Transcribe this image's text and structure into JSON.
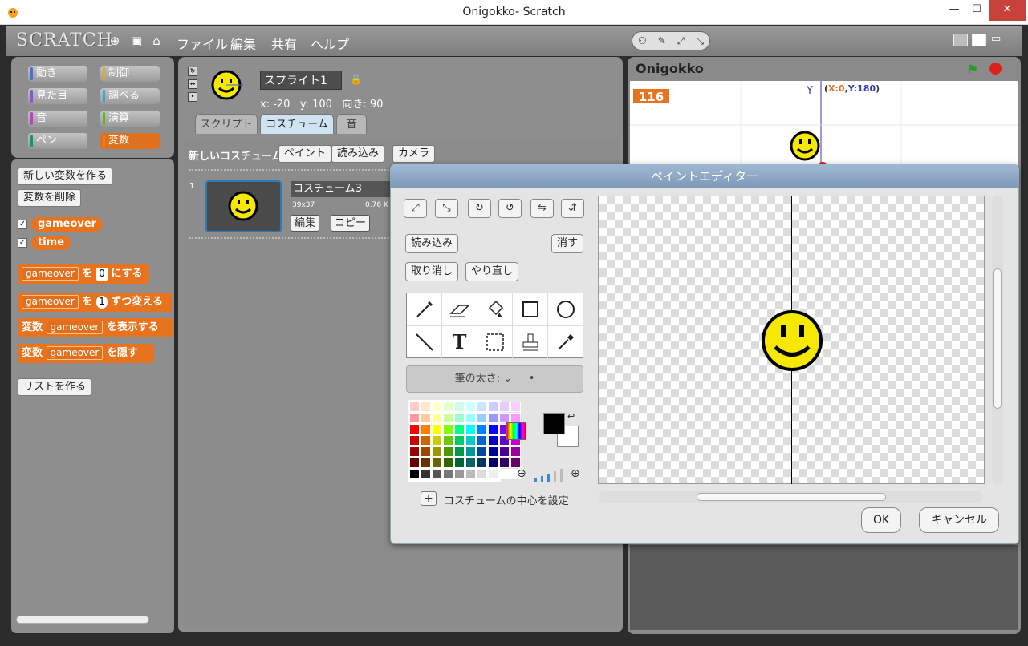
{
  "window": {
    "title": "Onigokko- Scratch",
    "minimize": "—",
    "maximize": "☐",
    "close": "✕"
  },
  "topbar": {
    "logo": "SCRATCH",
    "menus": [
      "ファイル",
      "編集",
      "共有",
      "ヘルプ"
    ],
    "mode_buttons": [
      "⚇",
      "✎",
      "⤢",
      "⤡"
    ]
  },
  "categories": [
    {
      "label": "動き",
      "color": "#4a6cd4"
    },
    {
      "label": "制御",
      "color": "#e1a91a"
    },
    {
      "label": "見た目",
      "color": "#8a55d7"
    },
    {
      "label": "調べる",
      "color": "#2ca5e2"
    },
    {
      "label": "音",
      "color": "#bb42c3"
    },
    {
      "label": "演算",
      "color": "#5cb712"
    },
    {
      "label": "ペン",
      "color": "#0e9a6c"
    },
    {
      "label": "変数",
      "color": "#ee7d16"
    }
  ],
  "palette": {
    "make_var": "新しい変数を作る",
    "delete_var": "変数を削除",
    "variables": [
      "gameover",
      "time"
    ],
    "blocks": {
      "set": {
        "var": "gameover",
        "to": "を",
        "value": "0",
        "suffix": "にする"
      },
      "change": {
        "var": "gameover",
        "by": "を",
        "value": "1",
        "suffix": "ずつ変える"
      },
      "show": {
        "prefix": "変数",
        "var": "gameover",
        "suffix": "を表示する"
      },
      "hide": {
        "prefix": "変数",
        "var": "gameover",
        "suffix": "を隠す"
      }
    },
    "make_list": "リストを作る"
  },
  "sprite": {
    "name": "スプライト1",
    "x_label": "x:",
    "x": "-20",
    "y_label": "y:",
    "y": "100",
    "dir_label": "向き:",
    "dir": "90"
  },
  "tabs": [
    "スクリプト",
    "コスチューム",
    "音"
  ],
  "costumes": {
    "new_label": "新しいコスチューム",
    "paint": "ペイント",
    "import": "読み込み",
    "camera": "カメラ",
    "index": "1",
    "name": "コスチューム3",
    "size": "39x37",
    "kb": "0.76 K",
    "edit": "編集",
    "copy": "コピー"
  },
  "stage": {
    "title": "Onigokko",
    "monitor_value": "116",
    "y_axis": "Y",
    "readout_x": "X:0",
    "readout_y": "Y:180"
  },
  "paint_editor": {
    "title": "ペイントエディター",
    "transform_icons": [
      "⤢",
      "⤡",
      "↻",
      "↺",
      "⇋",
      "⇵"
    ],
    "import": "読み込み",
    "clear": "消す",
    "undo": "取り消し",
    "redo": "やり直し",
    "tools": [
      "brush",
      "eraser",
      "fill",
      "rectangle",
      "ellipse",
      "line",
      "text",
      "select",
      "stamp",
      "eyedropper"
    ],
    "brush_size_label": "筆の太さ:",
    "set_center": "コスチュームの中心を設定",
    "ok": "OK",
    "cancel": "キャンセル",
    "primary_color": "#000000",
    "secondary_color": "#ffffff"
  },
  "palette_colors": [
    [
      "#ffcccc",
      "#ffe6cc",
      "#ffffcc",
      "#e6ffcc",
      "#ccffe6",
      "#ccffff",
      "#cce6ff",
      "#ccccff",
      "#e6ccff",
      "#ffccff"
    ],
    [
      "#ff9999",
      "#ffcc99",
      "#ffff99",
      "#ccff99",
      "#99ffcc",
      "#99ffff",
      "#99ccff",
      "#9999ff",
      "#cc99ff",
      "#ff99ff"
    ],
    [
      "#ff0000",
      "#ff8000",
      "#ffff00",
      "#80ff00",
      "#00ff80",
      "#00ffff",
      "#0080ff",
      "#0000ff",
      "#8000ff",
      "#ff00ff"
    ],
    [
      "#cc0000",
      "#cc6600",
      "#cccc00",
      "#66cc00",
      "#00cc66",
      "#00cccc",
      "#0066cc",
      "#0000cc",
      "#6600cc",
      "#cc00cc"
    ],
    [
      "#990000",
      "#994c00",
      "#999900",
      "#4c9900",
      "#00994c",
      "#009999",
      "#004c99",
      "#000099",
      "#4c0099",
      "#990099"
    ],
    [
      "#660000",
      "#663300",
      "#666600",
      "#336600",
      "#006633",
      "#006666",
      "#003366",
      "#000066",
      "#330066",
      "#660066"
    ],
    [
      "#000000",
      "#333333",
      "#555555",
      "#777777",
      "#999999",
      "#bbbbbb",
      "#dddddd",
      "#eeeeee",
      "#ffffff",
      "#ffffff"
    ]
  ]
}
